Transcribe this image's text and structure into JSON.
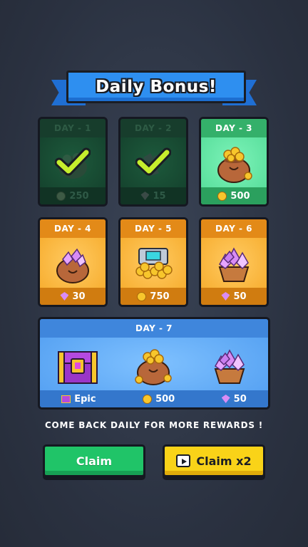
{
  "title": "Daily Bonus!",
  "days": [
    {
      "label": "DAY - 1",
      "reward_icon": "coin-icon",
      "amount": "250",
      "state": "claimed",
      "art": "coin-pot"
    },
    {
      "label": "DAY - 2",
      "reward_icon": "gem-icon",
      "amount": "15",
      "state": "claimed",
      "art": "gem-pile"
    },
    {
      "label": "DAY - 3",
      "reward_icon": "coin-icon",
      "amount": "500",
      "state": "current",
      "art": "coin-pot"
    },
    {
      "label": "DAY - 4",
      "reward_icon": "gem-icon",
      "amount": "30",
      "state": "future",
      "art": "gem-bag"
    },
    {
      "label": "DAY - 5",
      "reward_icon": "coin-icon",
      "amount": "750",
      "state": "future",
      "art": "coin-chest"
    },
    {
      "label": "DAY - 6",
      "reward_icon": "gem-icon",
      "amount": "50",
      "state": "future",
      "art": "gem-basket"
    }
  ],
  "day7": {
    "label": "DAY - 7",
    "rewards": [
      {
        "icon": "chest-icon",
        "text": "Epic"
      },
      {
        "icon": "coin-icon",
        "text": "500"
      },
      {
        "icon": "gem-icon",
        "text": "50"
      }
    ]
  },
  "tip": "COME BACK DAILY FOR MORE REWARDS !",
  "buttons": {
    "claim": "Claim",
    "claim_x2": "Claim x2"
  },
  "colors": {
    "claimed": "#1d5a3c",
    "current": "#4fd994",
    "future": "#f5a623",
    "day7": "#4f9cf0",
    "claim_button": "#20c468",
    "claim_x2_button": "#f9d318"
  }
}
